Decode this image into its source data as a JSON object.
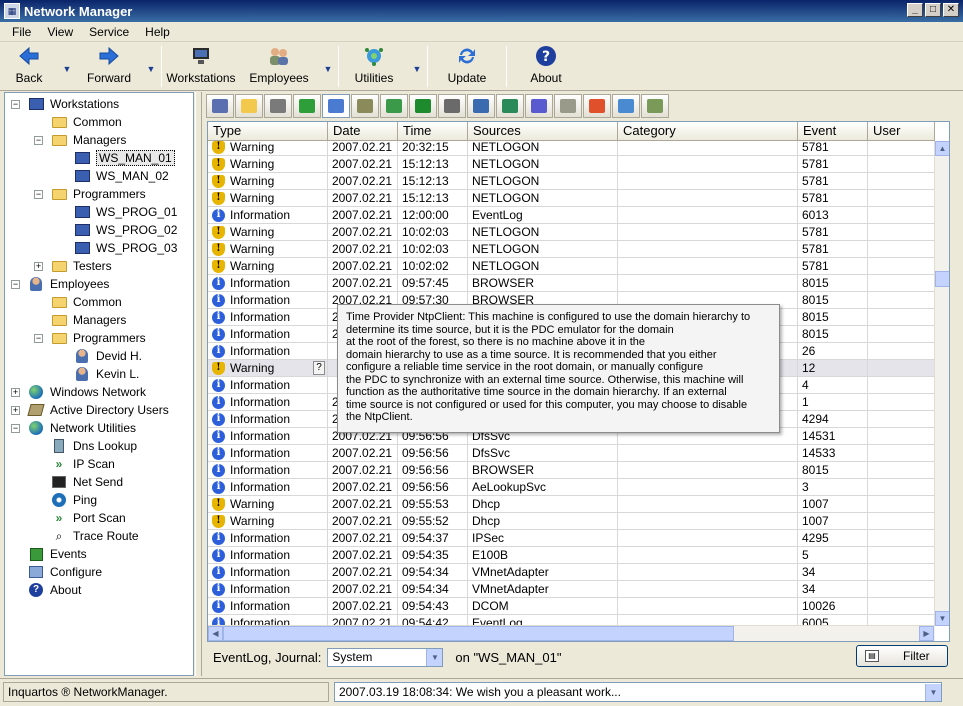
{
  "window": {
    "title": "Network Manager"
  },
  "menu": [
    "File",
    "View",
    "Service",
    "Help"
  ],
  "toolbar": {
    "back": "Back",
    "forward": "Forward",
    "workstations": "Workstations",
    "employees": "Employees",
    "utilities": "Utilities",
    "update": "Update",
    "about": "About"
  },
  "tree": [
    {
      "label": "Workstations",
      "level": 0,
      "exp": "−",
      "icon": "computer-icon"
    },
    {
      "label": "Common",
      "level": 1,
      "exp": "",
      "icon": "folder-icon"
    },
    {
      "label": "Managers",
      "level": 1,
      "exp": "−",
      "icon": "folder-icon"
    },
    {
      "label": "WS_MAN_01",
      "level": 2,
      "exp": "",
      "icon": "monitor-icon",
      "selected": true
    },
    {
      "label": "WS_MAN_02",
      "level": 2,
      "exp": "",
      "icon": "monitor-icon"
    },
    {
      "label": "Programmers",
      "level": 1,
      "exp": "−",
      "icon": "folder-icon"
    },
    {
      "label": "WS_PROG_01",
      "level": 2,
      "exp": "",
      "icon": "monitor-icon"
    },
    {
      "label": "WS_PROG_02",
      "level": 2,
      "exp": "",
      "icon": "monitor-icon"
    },
    {
      "label": "WS_PROG_03",
      "level": 2,
      "exp": "",
      "icon": "monitor-icon"
    },
    {
      "label": "Testers",
      "level": 1,
      "exp": "+",
      "icon": "folder-icon"
    },
    {
      "label": "Employees",
      "level": 0,
      "exp": "−",
      "icon": "users-icon"
    },
    {
      "label": "Common",
      "level": 1,
      "exp": "",
      "icon": "folder-icon"
    },
    {
      "label": "Managers",
      "level": 1,
      "exp": "",
      "icon": "folder-icon"
    },
    {
      "label": "Programmers",
      "level": 1,
      "exp": "−",
      "icon": "folder-icon"
    },
    {
      "label": "Devid H.",
      "level": 2,
      "exp": "",
      "icon": "person-icon"
    },
    {
      "label": "Kevin L.",
      "level": 2,
      "exp": "",
      "icon": "person-icon"
    },
    {
      "label": "Windows Network",
      "level": 0,
      "exp": "+",
      "icon": "globe-icon"
    },
    {
      "label": "Active Directory Users",
      "level": 0,
      "exp": "+",
      "icon": "book-icon"
    },
    {
      "label": "Network Utilities",
      "level": 0,
      "exp": "−",
      "icon": "globe-icon"
    },
    {
      "label": "Dns Lookup",
      "level": 1,
      "exp": "",
      "icon": "dns-icon"
    },
    {
      "label": "IP Scan",
      "level": 1,
      "exp": "",
      "icon": "scan-icon"
    },
    {
      "label": "Net Send",
      "level": 1,
      "exp": "",
      "icon": "console-icon"
    },
    {
      "label": "Ping",
      "level": 1,
      "exp": "",
      "icon": "ping-icon"
    },
    {
      "label": "Port Scan",
      "level": 1,
      "exp": "",
      "icon": "scan-icon"
    },
    {
      "label": "Trace Route",
      "level": 1,
      "exp": "",
      "icon": "magnifier-icon"
    },
    {
      "label": "Events",
      "level": 0,
      "exp": "",
      "icon": "events-icon"
    },
    {
      "label": "Configure",
      "level": 0,
      "exp": "",
      "icon": "configure-icon"
    },
    {
      "label": "About",
      "level": 0,
      "exp": "",
      "icon": "help-icon"
    }
  ],
  "iconbar": [
    {
      "icon": "computer-icon",
      "color": "#5a6fb0"
    },
    {
      "icon": "notepad-icon",
      "color": "#f2c94c"
    },
    {
      "icon": "disk-icon",
      "color": "#7a7a7a"
    },
    {
      "icon": "refresh-icon",
      "color": "#2e9e3a"
    },
    {
      "icon": "eventlog-icon",
      "color": "#4a7bd0",
      "active": true
    },
    {
      "icon": "network-icon",
      "color": "#8a8a5a"
    },
    {
      "icon": "process-icon",
      "color": "#3a9a4a"
    },
    {
      "icon": "memory-icon",
      "color": "#1e8a2e"
    },
    {
      "icon": "printer-icon",
      "color": "#6a6a6a"
    },
    {
      "icon": "display-icon",
      "color": "#3a6ab0"
    },
    {
      "icon": "services-icon",
      "color": "#2a8a5a"
    },
    {
      "icon": "cdrom-icon",
      "color": "#5a5ad0"
    },
    {
      "icon": "drive-icon",
      "color": "#9a9a8a"
    },
    {
      "icon": "windows-icon",
      "color": "#e0502a"
    },
    {
      "icon": "tools-icon",
      "color": "#4a8ad0"
    },
    {
      "icon": "users-icon",
      "color": "#7a9a5a"
    }
  ],
  "grid": {
    "columns": [
      "Type",
      "Date",
      "Time",
      "Sources",
      "Category",
      "Event",
      "User"
    ],
    "rows": [
      {
        "type": "Warning",
        "date": "2007.02.21",
        "time": "20:32:15",
        "source": "NETLOGON",
        "category": "",
        "event": "5781",
        "user": ""
      },
      {
        "type": "Warning",
        "date": "2007.02.21",
        "time": "15:12:13",
        "source": "NETLOGON",
        "category": "",
        "event": "5781",
        "user": ""
      },
      {
        "type": "Warning",
        "date": "2007.02.21",
        "time": "15:12:13",
        "source": "NETLOGON",
        "category": "",
        "event": "5781",
        "user": ""
      },
      {
        "type": "Warning",
        "date": "2007.02.21",
        "time": "15:12:13",
        "source": "NETLOGON",
        "category": "",
        "event": "5781",
        "user": ""
      },
      {
        "type": "Information",
        "date": "2007.02.21",
        "time": "12:00:00",
        "source": "EventLog",
        "category": "",
        "event": "6013",
        "user": ""
      },
      {
        "type": "Warning",
        "date": "2007.02.21",
        "time": "10:02:03",
        "source": "NETLOGON",
        "category": "",
        "event": "5781",
        "user": ""
      },
      {
        "type": "Warning",
        "date": "2007.02.21",
        "time": "10:02:03",
        "source": "NETLOGON",
        "category": "",
        "event": "5781",
        "user": ""
      },
      {
        "type": "Warning",
        "date": "2007.02.21",
        "time": "10:02:02",
        "source": "NETLOGON",
        "category": "",
        "event": "5781",
        "user": ""
      },
      {
        "type": "Information",
        "date": "2007.02.21",
        "time": "09:57:45",
        "source": "BROWSER",
        "category": "",
        "event": "8015",
        "user": ""
      },
      {
        "type": "Information",
        "date": "2007.02.21",
        "time": "09:57:30",
        "source": "BROWSER",
        "category": "",
        "event": "8015",
        "user": ""
      },
      {
        "type": "Information",
        "date": "2",
        "time": "",
        "source": "",
        "category": "",
        "event": "8015",
        "user": ""
      },
      {
        "type": "Information",
        "date": "2",
        "time": "",
        "source": "",
        "category": "",
        "event": "8015",
        "user": ""
      },
      {
        "type": "Information",
        "date": "",
        "time": "",
        "source": "",
        "category": "",
        "event": "26",
        "user": ""
      },
      {
        "type": "Warning",
        "date": "",
        "time": "",
        "source": "",
        "category": "",
        "event": "12",
        "user": "",
        "highlight": true
      },
      {
        "type": "Information",
        "date": "",
        "time": "",
        "source": "",
        "category": "",
        "event": "4",
        "user": ""
      },
      {
        "type": "Information",
        "date": "2",
        "time": "",
        "source": "",
        "category": "",
        "event": "1",
        "user": ""
      },
      {
        "type": "Information",
        "date": "2",
        "time": "",
        "source": "",
        "category": "",
        "event": "4294",
        "user": ""
      },
      {
        "type": "Information",
        "date": "2007.02.21",
        "time": "09:56:56",
        "source": "DfsSvc",
        "category": "",
        "event": "14531",
        "user": ""
      },
      {
        "type": "Information",
        "date": "2007.02.21",
        "time": "09:56:56",
        "source": "DfsSvc",
        "category": "",
        "event": "14533",
        "user": ""
      },
      {
        "type": "Information",
        "date": "2007.02.21",
        "time": "09:56:56",
        "source": "BROWSER",
        "category": "",
        "event": "8015",
        "user": ""
      },
      {
        "type": "Information",
        "date": "2007.02.21",
        "time": "09:56:56",
        "source": "AeLookupSvc",
        "category": "",
        "event": "3",
        "user": ""
      },
      {
        "type": "Warning",
        "date": "2007.02.21",
        "time": "09:55:53",
        "source": "Dhcp",
        "category": "",
        "event": "1007",
        "user": ""
      },
      {
        "type": "Warning",
        "date": "2007.02.21",
        "time": "09:55:52",
        "source": "Dhcp",
        "category": "",
        "event": "1007",
        "user": ""
      },
      {
        "type": "Information",
        "date": "2007.02.21",
        "time": "09:54:37",
        "source": "IPSec",
        "category": "",
        "event": "4295",
        "user": ""
      },
      {
        "type": "Information",
        "date": "2007.02.21",
        "time": "09:54:35",
        "source": "E100B",
        "category": "",
        "event": "5",
        "user": ""
      },
      {
        "type": "Information",
        "date": "2007.02.21",
        "time": "09:54:34",
        "source": "VMnetAdapter",
        "category": "",
        "event": "34",
        "user": ""
      },
      {
        "type": "Information",
        "date": "2007.02.21",
        "time": "09:54:34",
        "source": "VMnetAdapter",
        "category": "",
        "event": "34",
        "user": ""
      },
      {
        "type": "Information",
        "date": "2007.02.21",
        "time": "09:54:43",
        "source": "DCOM",
        "category": "",
        "event": "10026",
        "user": ""
      },
      {
        "type": "Information",
        "date": "2007.02.21",
        "time": "09:54:42",
        "source": "EventLog",
        "category": "",
        "event": "6005",
        "user": ""
      }
    ]
  },
  "tooltip": {
    "lines": [
      "Time Provider NtpClient: This machine is configured to use the domain hierarchy to",
      "determine its time source, but it is the PDC emulator for the domain",
      "at the root of the forest, so there is no machine above it in the",
      "domain hierarchy to use as a time source.  It is recommended that you either",
      "configure a reliable time service in the root domain, or manually configure",
      "the PDC to synchronize with an external time source.  Otherwise, this machine will",
      "function as the authoritative time source in the domain hierarchy.  If an external",
      "time source is not configured or used for this computer, you may choose to disable",
      "the NtpClient."
    ],
    "qmark": "?"
  },
  "bottom": {
    "label": "EventLog, Journal:",
    "journal": "System",
    "on_text": "on \"WS_MAN_01\"",
    "filter": "Filter"
  },
  "status": {
    "left": "Inquartos ® NetworkManager.",
    "message": "2007.03.19 18:08:34: We wish you a pleasant work..."
  }
}
